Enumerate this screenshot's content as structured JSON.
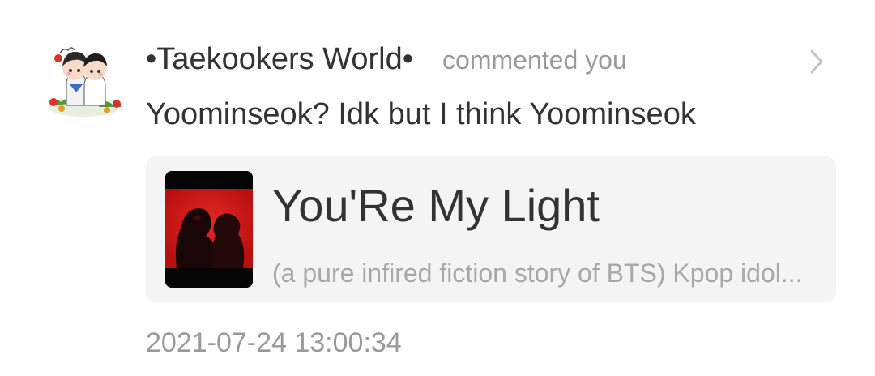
{
  "notification": {
    "username": "•Taekookers World•",
    "action": "commented you",
    "comment": "Yoominseok? Idk but I think Yoominseok",
    "timestamp": "2021-07-24 13:00:34",
    "avatar_icon": "chibi-couple-avatar",
    "chevron_icon": "chevron-right-icon"
  },
  "story_card": {
    "title": "You'Re My Light",
    "description": "(a pure infired fiction story of BTS) Kpop idol...",
    "cover_colors": {
      "background": "#d81818",
      "bars": "#050505"
    }
  },
  "colors": {
    "primary_text": "#333333",
    "secondary_text": "#9a9a9a",
    "card_background": "#f4f4f4"
  }
}
